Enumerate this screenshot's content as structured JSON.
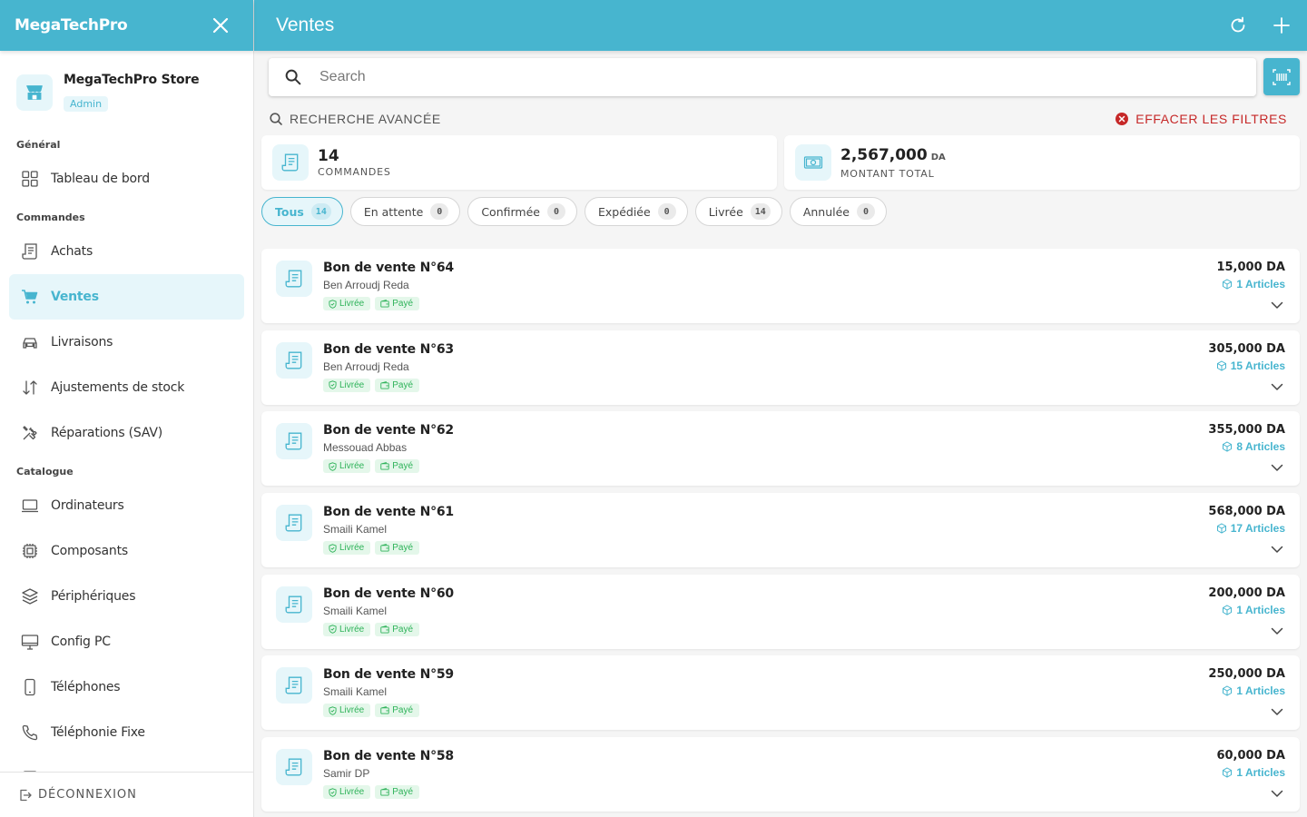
{
  "sidebar": {
    "brand": "MegaTechPro",
    "store_name": "MegaTechPro Store",
    "store_role": "Admin",
    "sections": {
      "general": "Général",
      "commandes": "Commandes",
      "catalogue": "Catalogue"
    },
    "items": {
      "dashboard": "Tableau de bord",
      "achats": "Achats",
      "ventes": "Ventes",
      "livraisons": "Livraisons",
      "ajustements": "Ajustements de stock",
      "reparations": "Réparations (SAV)",
      "ordinateurs": "Ordinateurs",
      "composants": "Composants",
      "peripheriques": "Périphériques",
      "config_pc": "Config PC",
      "telephones": "Téléphones",
      "telephonie_fixe": "Téléphonie Fixe"
    },
    "logout": "DÉCONNEXION"
  },
  "header": {
    "title": "Ventes"
  },
  "search": {
    "placeholder": "Search"
  },
  "filters": {
    "advanced": "RECHERCHE AVANCÉE",
    "clear": "EFFACER LES FILTRES"
  },
  "stats": {
    "orders": {
      "value": "14",
      "label": "COMMANDES"
    },
    "total": {
      "value": "2,567,000",
      "unit": "DA",
      "label": "MONTANT TOTAL"
    }
  },
  "chips": [
    {
      "label": "Tous",
      "count": "14"
    },
    {
      "label": "En attente",
      "count": "0"
    },
    {
      "label": "Confirmée",
      "count": "0"
    },
    {
      "label": "Expédiée",
      "count": "0"
    },
    {
      "label": "Livrée",
      "count": "14"
    },
    {
      "label": "Annulée",
      "count": "0"
    }
  ],
  "orders": [
    {
      "title": "Bon de vente N°64",
      "client": "Ben Arroudj Reda",
      "delivery": "Livrée",
      "payment": "Payé",
      "amount": "15,000 DA",
      "articles": "1 Articles"
    },
    {
      "title": "Bon de vente N°63",
      "client": "Ben Arroudj Reda",
      "delivery": "Livrée",
      "payment": "Payé",
      "amount": "305,000 DA",
      "articles": "15 Articles"
    },
    {
      "title": "Bon de vente N°62",
      "client": "Messouad Abbas",
      "delivery": "Livrée",
      "payment": "Payé",
      "amount": "355,000 DA",
      "articles": "8 Articles"
    },
    {
      "title": "Bon de vente N°61",
      "client": "Smaili Kamel",
      "delivery": "Livrée",
      "payment": "Payé",
      "amount": "568,000 DA",
      "articles": "17 Articles"
    },
    {
      "title": "Bon de vente N°60",
      "client": "Smaili Kamel",
      "delivery": "Livrée",
      "payment": "Payé",
      "amount": "200,000 DA",
      "articles": "1 Articles"
    },
    {
      "title": "Bon de vente N°59",
      "client": "Smaili Kamel",
      "delivery": "Livrée",
      "payment": "Payé",
      "amount": "250,000 DA",
      "articles": "1 Articles"
    },
    {
      "title": "Bon de vente N°58",
      "client": "Samir DP",
      "delivery": "Livrée",
      "payment": "Payé",
      "amount": "60,000 DA",
      "articles": "1 Articles"
    }
  ],
  "colors": {
    "accent": "#47b5cf",
    "accent_soft": "#e6f6fa",
    "success": "#2fb35a",
    "danger": "#c62828"
  }
}
